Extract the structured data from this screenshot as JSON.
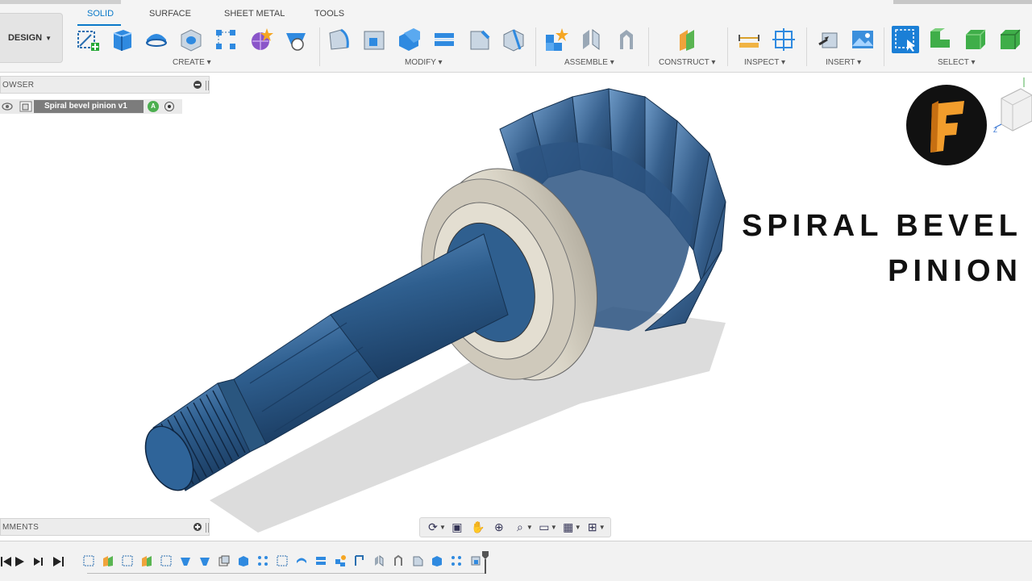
{
  "toolbar": {
    "workspace_label": "DESIGN",
    "tabs": [
      "SOLID",
      "SURFACE",
      "SHEET METAL",
      "TOOLS"
    ],
    "active_tab": "SOLID",
    "groups": [
      "CREATE",
      "MODIFY",
      "ASSEMBLE",
      "CONSTRUCT",
      "INSPECT",
      "INSERT",
      "SELECT"
    ]
  },
  "browser": {
    "title": "OWSER",
    "component_name": "Spiral bevel pinion v1"
  },
  "comments": {
    "title": "MMENTS"
  },
  "overlay": {
    "title_line1": "SPIRAL BEVEL",
    "title_line2": "PINION",
    "logo_letter": "F"
  },
  "colors": {
    "accent": "#0a79c9",
    "part_blue": "#2f5f8f",
    "bearing": "#d9d4c6"
  },
  "icons": {
    "navbar": [
      "orbit-icon",
      "look-at-icon",
      "pan-icon",
      "zoom-icon",
      "zoom-window-icon",
      "display-settings-icon",
      "grid-icon",
      "viewports-icon"
    ],
    "timeline_controls": [
      "skip-start-icon",
      "play-icon",
      "step-forward-icon",
      "skip-end-icon"
    ]
  }
}
